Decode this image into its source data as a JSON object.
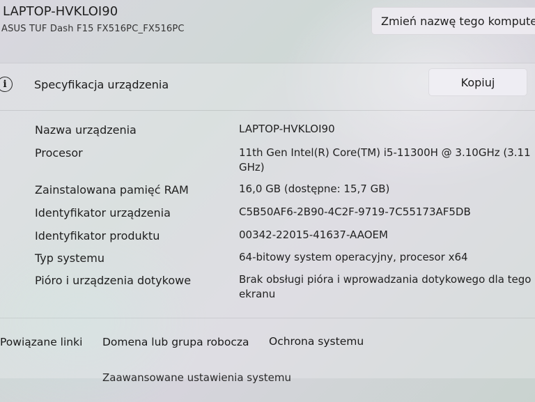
{
  "device": {
    "name": "LAPTOP-HVKLOI90",
    "model": "ASUS TUF Dash F15 FX516PC_FX516PC",
    "rename_label": "Zmień nazwę tego komputera"
  },
  "specs": {
    "title": "Specyfikacja urządzenia",
    "copy_label": "Kopiuj",
    "rows": [
      {
        "label": "Nazwa urządzenia",
        "value": "LAPTOP-HVKLOI90"
      },
      {
        "label": "Procesor",
        "value": "11th Gen Intel(R) Core(TM) i5-11300H @ 3.10GHz (3.11 GHz)"
      },
      {
        "label": "Zainstalowana pamięć RAM",
        "value": "16,0 GB (dostępne: 15,7 GB)"
      },
      {
        "label": "Identyfikator urządzenia",
        "value": "C5B50AF6-2B90-4C2F-9719-7C55173AF5DB"
      },
      {
        "label": "Identyfikator produktu",
        "value": "00342-22015-41637-AAOEM"
      },
      {
        "label": "Typ systemu",
        "value": "64-bitowy system operacyjny, procesor x64"
      },
      {
        "label": "Pióro i urządzenia dotykowe",
        "value": "Brak obsługi pióra i wprowadzania dotykowego dla tego ekranu"
      }
    ]
  },
  "related": {
    "title": "Powiązane linki",
    "links": [
      "Domena lub grupa robocza",
      "Ochrona systemu",
      "Zaawansowane ustawienia systemu"
    ]
  }
}
